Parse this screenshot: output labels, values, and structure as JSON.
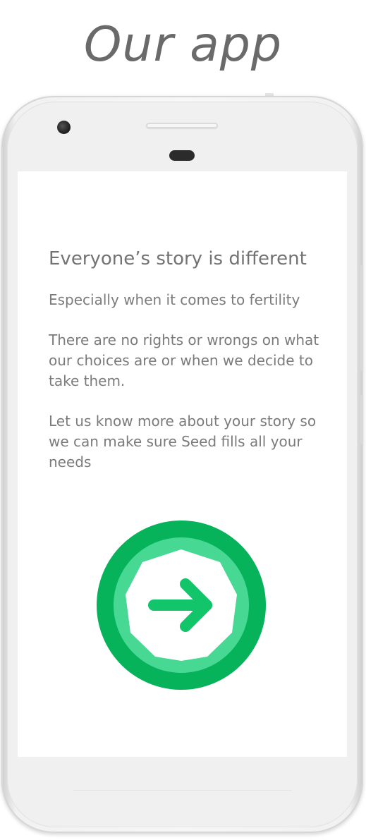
{
  "page": {
    "heading": "Our app"
  },
  "screen": {
    "title": "Everyone’s story is different",
    "paragraphs": [
      "Especially when it comes to fertility",
      "There are no rights or wrongs on what our choices are or when we decide to take them.",
      "Let us know more about your story so we can make sure Seed fills all your needs"
    ],
    "next_button": {
      "icon": "arrow-right-icon",
      "colors": {
        "outer": "#06b35a",
        "middle": "#47d994",
        "inner": "#ffffff",
        "arrow": "#12c46a"
      }
    }
  }
}
